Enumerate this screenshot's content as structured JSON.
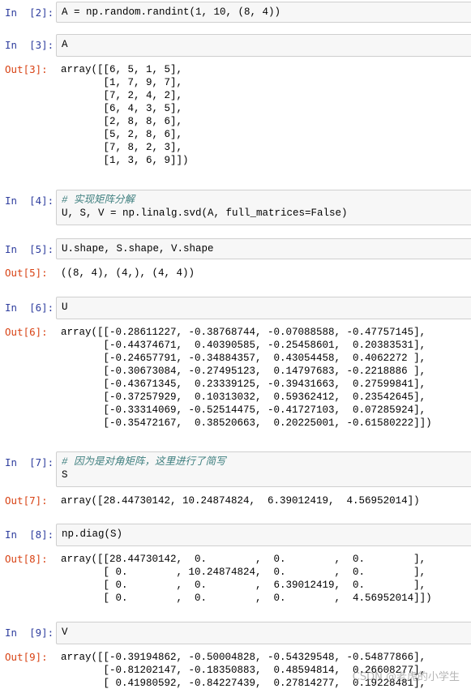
{
  "cells": [
    {
      "in_prompt": "In  [2]:",
      "code_lines": [
        "A = np.random.randint(1, 10, (8, 4))"
      ]
    },
    {
      "in_prompt": "In  [3]:",
      "code_lines": [
        "A"
      ],
      "out_prompt": "Out[3]:",
      "output_lines": [
        "array([[6, 5, 1, 5],",
        "       [1, 7, 9, 7],",
        "       [7, 2, 4, 2],",
        "       [6, 4, 3, 5],",
        "       [2, 8, 8, 6],",
        "       [5, 2, 8, 6],",
        "       [7, 8, 2, 3],",
        "       [1, 3, 6, 9]])"
      ]
    },
    {
      "in_prompt": "In  [4]:",
      "code_lines": [
        "# 实现矩阵分解",
        "U, S, V = np.linalg.svd(A, full_matrices=False)"
      ]
    },
    {
      "in_prompt": "In  [5]:",
      "code_lines": [
        "U.shape, S.shape, V.shape"
      ],
      "out_prompt": "Out[5]:",
      "output_lines": [
        "((8, 4), (4,), (4, 4))"
      ]
    },
    {
      "in_prompt": "In  [6]:",
      "code_lines": [
        "U"
      ],
      "out_prompt": "Out[6]:",
      "output_lines": [
        "array([[-0.28611227, -0.38768744, -0.07088588, -0.47757145],",
        "       [-0.44374671,  0.40390585, -0.25458601,  0.20383531],",
        "       [-0.24657791, -0.34884357,  0.43054458,  0.4062272 ],",
        "       [-0.30673084, -0.27495123,  0.14797683, -0.2218886 ],",
        "       [-0.43671345,  0.23339125, -0.39431663,  0.27599841],",
        "       [-0.37257929,  0.10313032,  0.59362412,  0.23542645],",
        "       [-0.33314069, -0.52514475, -0.41727103,  0.07285924],",
        "       [-0.35472167,  0.38520663,  0.20225001, -0.61580222]])"
      ]
    },
    {
      "in_prompt": "In  [7]:",
      "code_lines": [
        "# 因为是对角矩阵，这里进行了简写",
        "S"
      ],
      "out_prompt": "Out[7]:",
      "output_lines": [
        "array([28.44730142, 10.24874824,  6.39012419,  4.56952014])"
      ]
    },
    {
      "in_prompt": "In  [8]:",
      "code_lines": [
        "np.diag(S)"
      ],
      "out_prompt": "Out[8]:",
      "output_lines": [
        "array([[28.44730142,  0.        ,  0.        ,  0.        ],",
        "       [ 0.        , 10.24874824,  0.        ,  0.        ],",
        "       [ 0.        ,  0.        ,  6.39012419,  0.        ],",
        "       [ 0.        ,  0.        ,  0.        ,  4.56952014]])"
      ]
    },
    {
      "in_prompt": "In  [9]:",
      "code_lines": [
        "V"
      ],
      "out_prompt": "Out[9]:",
      "output_lines": [
        "array([[-0.39194862, -0.50004828, -0.54329548, -0.54877866],",
        "       [-0.81202147, -0.18350883,  0.48594814,  0.26608277],",
        "       [ 0.41980592, -0.84227439,  0.27814277,  0.19228481],"
      ]
    }
  ],
  "watermark": "CSDN @老虎的小学生"
}
